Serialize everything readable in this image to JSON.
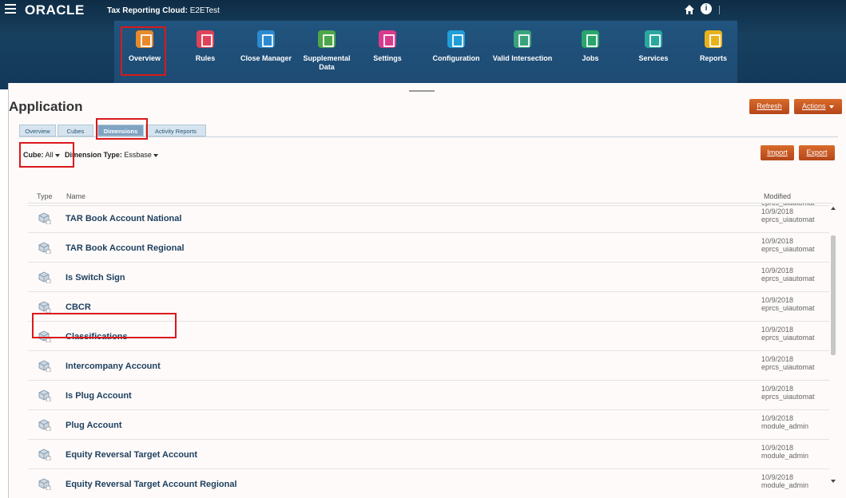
{
  "topbar": {
    "brand": "ORACLE",
    "app_title": "Tax Reporting Cloud:",
    "env": "E2ETest"
  },
  "nav": {
    "items": [
      {
        "label": "Overview",
        "icon": "overview-icon",
        "color": "#e8892c"
      },
      {
        "label": "Rules",
        "icon": "rules-icon",
        "color": "#e04358"
      },
      {
        "label": "Close Manager",
        "icon": "close-manager-icon",
        "color": "#2e8ad0"
      },
      {
        "label": "Supplemental Data",
        "icon": "supplemental-data-icon",
        "color": "#4da64a"
      },
      {
        "label": "Settings",
        "icon": "settings-icon",
        "color": "#d93a8b"
      },
      {
        "label": "Configuration",
        "icon": "configuration-icon",
        "color": "#1f9ed8"
      },
      {
        "label": "Valid Intersection",
        "icon": "valid-intersection-icon",
        "color": "#3aa37c"
      },
      {
        "label": "Jobs",
        "icon": "jobs-icon",
        "color": "#2aa56c"
      },
      {
        "label": "Services",
        "icon": "services-icon",
        "color": "#2aa8a0"
      },
      {
        "label": "Reports",
        "icon": "reports-icon",
        "color": "#e8b21e"
      }
    ]
  },
  "page": {
    "title": "Application",
    "refresh_label": "Refresh",
    "actions_label": "Actions"
  },
  "tabs": [
    "Overview",
    "Cubes",
    "Dimensions",
    "Activity Reports"
  ],
  "filters": {
    "cube_label": "Cube:",
    "cube_value": "All",
    "dim_type_label": "Dimension Type:",
    "dim_type_value": "Essbase"
  },
  "buttons": {
    "import": "Import",
    "export": "Export"
  },
  "columns": {
    "type": "Type",
    "name": "Name",
    "modified": "Modified"
  },
  "partial_row_modified": "eprcs_uiautomat",
  "rows": [
    {
      "name": "TAR Book Account National",
      "date": "10/9/2018",
      "user": "eprcs_uiautomat"
    },
    {
      "name": "TAR Book Account Regional",
      "date": "10/9/2018",
      "user": "eprcs_uiautomat"
    },
    {
      "name": "Is Switch Sign",
      "date": "10/9/2018",
      "user": "eprcs_uiautomat"
    },
    {
      "name": "CBCR",
      "date": "10/9/2018",
      "user": "eprcs_uiautomat"
    },
    {
      "name": "Classifications",
      "date": "10/9/2018",
      "user": "eprcs_uiautomat"
    },
    {
      "name": "Intercompany Account",
      "date": "10/9/2018",
      "user": "eprcs_uiautomat"
    },
    {
      "name": "Is Plug Account",
      "date": "10/9/2018",
      "user": "eprcs_uiautomat"
    },
    {
      "name": "Plug Account",
      "date": "10/9/2018",
      "user": "module_admin"
    },
    {
      "name": "Equity Reversal Target Account",
      "date": "10/9/2018",
      "user": "module_admin"
    },
    {
      "name": "Equity Reversal Target Account Regional",
      "date": "10/9/2018",
      "user": "module_admin"
    }
  ],
  "colors": {
    "accent_orange": "#c9581f",
    "banner": "#12375a",
    "highlight_red": "#d9191c"
  }
}
